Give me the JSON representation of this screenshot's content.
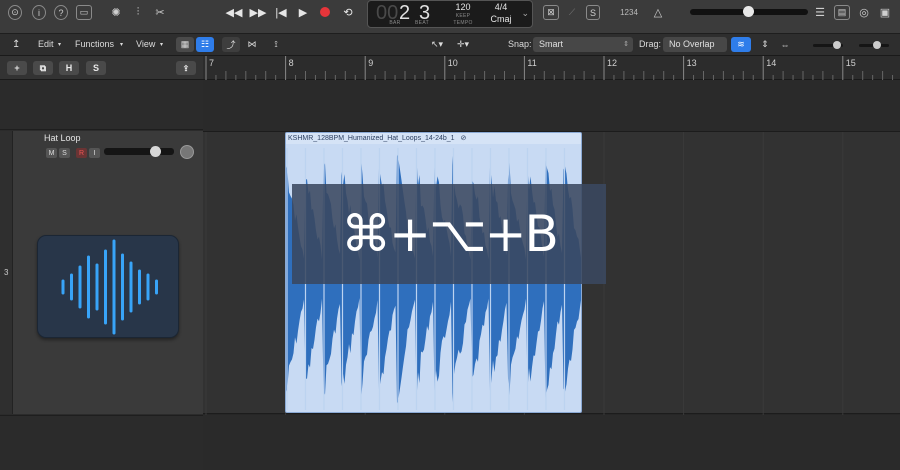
{
  "control_bar": {
    "lcd": {
      "bar_prefix": "00",
      "bar": "2",
      "beat": "3",
      "bar_label": "BAR",
      "beat_label": "BEAT",
      "tempo": "120",
      "tempo_mode": "KEEP",
      "tempo_label": "TEMPO",
      "time_signature": "4/4",
      "key": "Cmaj"
    },
    "count_in": "1234",
    "colors": {
      "record": "#e6353a",
      "accent": "#2f7dea"
    }
  },
  "edit_bar": {
    "menus": [
      "Edit",
      "Functions",
      "View"
    ],
    "snap_label": "Snap:",
    "snap_value": "Smart",
    "drag_label": "Drag:",
    "drag_value": "No Overlap"
  },
  "track_header": {
    "buttons": {
      "add": "+",
      "folder": "⧉",
      "h": "H",
      "s": "S"
    }
  },
  "ruler": {
    "bars": [
      "7",
      "8",
      "9",
      "10",
      "11",
      "12",
      "13",
      "14",
      "15"
    ]
  },
  "track": {
    "number": "3",
    "name": "Hat Loop",
    "mute": "M",
    "solo": "S",
    "record": "R",
    "input": "I"
  },
  "region": {
    "name": "KSHMR_128BPM_Humanized_Hat_Loops_14-24b_1"
  },
  "overlay": {
    "shortcut": "⌘+⌥+B"
  }
}
